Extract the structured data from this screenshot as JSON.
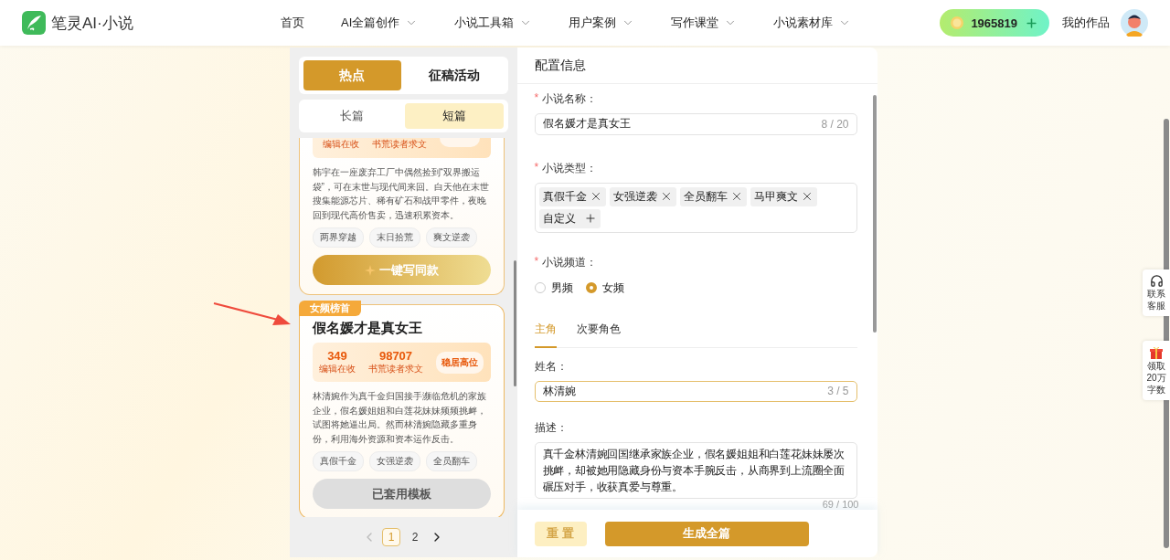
{
  "header": {
    "brand": "笔灵AI·小说",
    "nav": [
      {
        "label": "首页",
        "dropdown": false
      },
      {
        "label": "AI全篇创作",
        "dropdown": true
      },
      {
        "label": "小说工具箱",
        "dropdown": true
      },
      {
        "label": "用户案例",
        "dropdown": true
      },
      {
        "label": "写作课堂",
        "dropdown": true
      },
      {
        "label": "小说素材库",
        "dropdown": true
      }
    ],
    "coins": "1965819",
    "my_works": "我的作品"
  },
  "templates": {
    "tabs": [
      {
        "label": "热点",
        "selected": true
      },
      {
        "label": "征稿活动",
        "selected": false
      }
    ],
    "subtabs": [
      {
        "label": "长篇",
        "selected": false
      },
      {
        "label": "短篇",
        "selected": true
      }
    ],
    "cards": [
      {
        "kind": "partial",
        "stats": [
          {
            "label": "编辑在收"
          },
          {
            "label": "书荒读者求文"
          }
        ],
        "description": "韩宇在一座废弃工厂中偶然捡到“双界搬运袋”，可在末世与现代间来回。白天他在末世搜集能源芯片、稀有矿石和战甲零件，夜晚回到现代高价售卖，迅速积累资本。",
        "tags": [
          "两界穿越",
          "末日拾荒",
          "爽文逆袭"
        ],
        "button": {
          "label": "一键写同款",
          "applied": false
        },
        "pointed": false
      },
      {
        "kind": "full",
        "ribbon": "女频榜首",
        "title": "假名媛才是真女王",
        "stats": [
          {
            "value": "349",
            "label": "编辑在收"
          },
          {
            "value": "98707",
            "label": "书荒读者求文"
          }
        ],
        "badge": "稳居高位",
        "description": "林清婉作为真千金归国接手濒临危机的家族企业，假名媛姐姐和白莲花妹妹频频挑衅，试图将她逼出局。然而林清婉隐藏多重身份，利用海外资源和资本运作反击。",
        "tags": [
          "真假千金",
          "女强逆袭",
          "全员翻车"
        ],
        "button": {
          "label": "已套用模板",
          "applied": true
        },
        "pointed": true
      }
    ],
    "pages": [
      {
        "label": "1",
        "selected": true
      },
      {
        "label": "2",
        "selected": false
      }
    ]
  },
  "config": {
    "title": "配置信息",
    "name_field": {
      "mark": "*",
      "label": "小说名称：",
      "value": "假名媛才是真女王",
      "count": "8 / 20"
    },
    "genre_field": {
      "mark": "*",
      "label": "小说类型：",
      "tags": [
        "真假千金",
        "女强逆袭",
        "全员翻车",
        "马甲爽文"
      ],
      "custom": "自定义"
    },
    "channel_field": {
      "mark": "*",
      "label": "小说频道：",
      "options": [
        {
          "label": "男频",
          "selected": false
        },
        {
          "label": "女频",
          "selected": true
        }
      ]
    },
    "role_tabs": [
      {
        "label": "主角",
        "selected": true
      },
      {
        "label": "次要角色",
        "selected": false
      }
    ],
    "role_name": {
      "label": "姓名：",
      "value": "林清婉",
      "count": "3 / 5",
      "focused": true
    },
    "role_desc": {
      "label": "描述：",
      "value": "真千金林清婉回国继承家族企业，假名媛姐姐和白莲花妹妹屡次挑衅，却被她用隐藏身份与资本手腕反击，从商界到上流圈全面碾压对手，收获真爱与尊重。",
      "count": "69 / 100"
    },
    "reset": "重 置",
    "generate": "生成全篇"
  },
  "side_widgets": [
    {
      "kind": "service",
      "lines": [
        "联系",
        "客服"
      ]
    },
    {
      "kind": "gift",
      "lines": [
        "领取",
        "20万",
        "字数"
      ]
    }
  ]
}
